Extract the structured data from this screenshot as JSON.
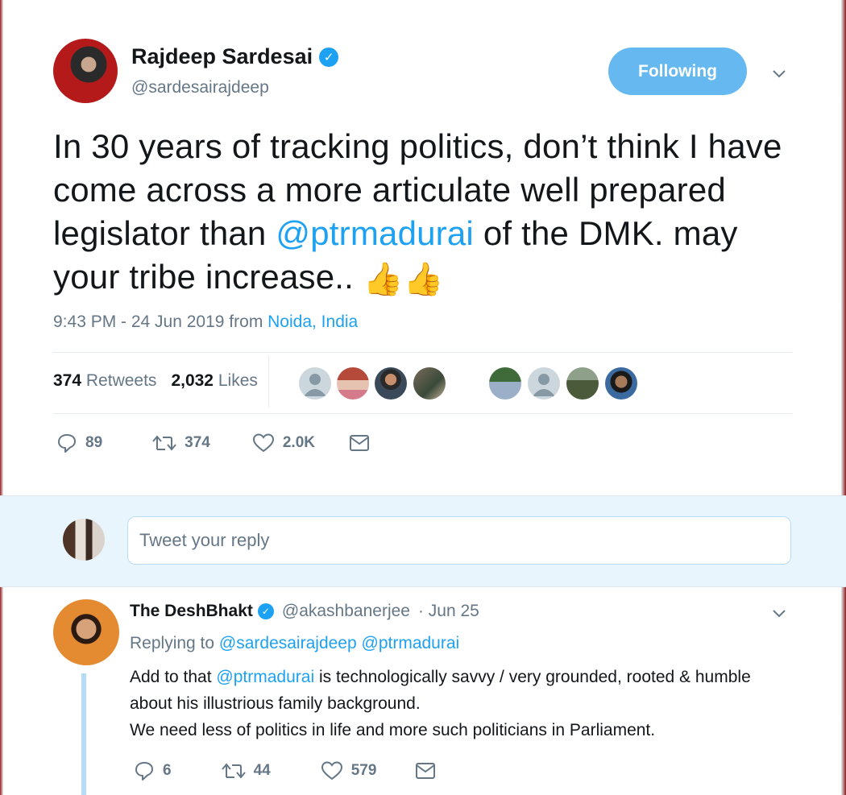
{
  "tweet": {
    "author_name": "Rajdeep Sardesai",
    "author_handle": "@sardesairajdeep",
    "follow_label": "Following",
    "text_1": "In 30 years of tracking politics, don’t think I have come across a more articulate well prepared legislator than ",
    "mention": "@ptrmadurai",
    "text_2": " of the DMK. may your tribe increase.. ",
    "emoji_1": "👍",
    "emoji_2": "👍",
    "time": "9:43 PM - 24 Jun 2019 from ",
    "location": "Noida, India",
    "retweets_count": "374",
    "retweets_label": "Retweets",
    "likes_count": "2,032",
    "likes_label": "Likes",
    "actions": {
      "reply_count": "89",
      "retweet_count": "374",
      "like_count": "2.0K"
    }
  },
  "reply_box": {
    "placeholder": "Tweet your reply"
  },
  "reply": {
    "author_name": "The DeshBhakt",
    "author_handle": "@akashbanerjee",
    "date": "· Jun 25",
    "replying_to_label": "Replying to",
    "replying_to_1": "@sardesairajdeep",
    "replying_to_2": "@ptrmadurai",
    "text_prefix": "Add to that ",
    "text_mention": "@ptrmadurai",
    "text_rest": " is technologically savvy / very grounded, rooted & humble about his illustrious family background.",
    "text_line2": "We need less of politics in life and more such politicians in Parliament.",
    "actions": {
      "reply_count": "6",
      "retweet_count": "44",
      "like_count": "579"
    }
  },
  "colors": {
    "accent": "#1da1f2",
    "muted": "#657786",
    "reply_bg": "#e8f5fd"
  }
}
